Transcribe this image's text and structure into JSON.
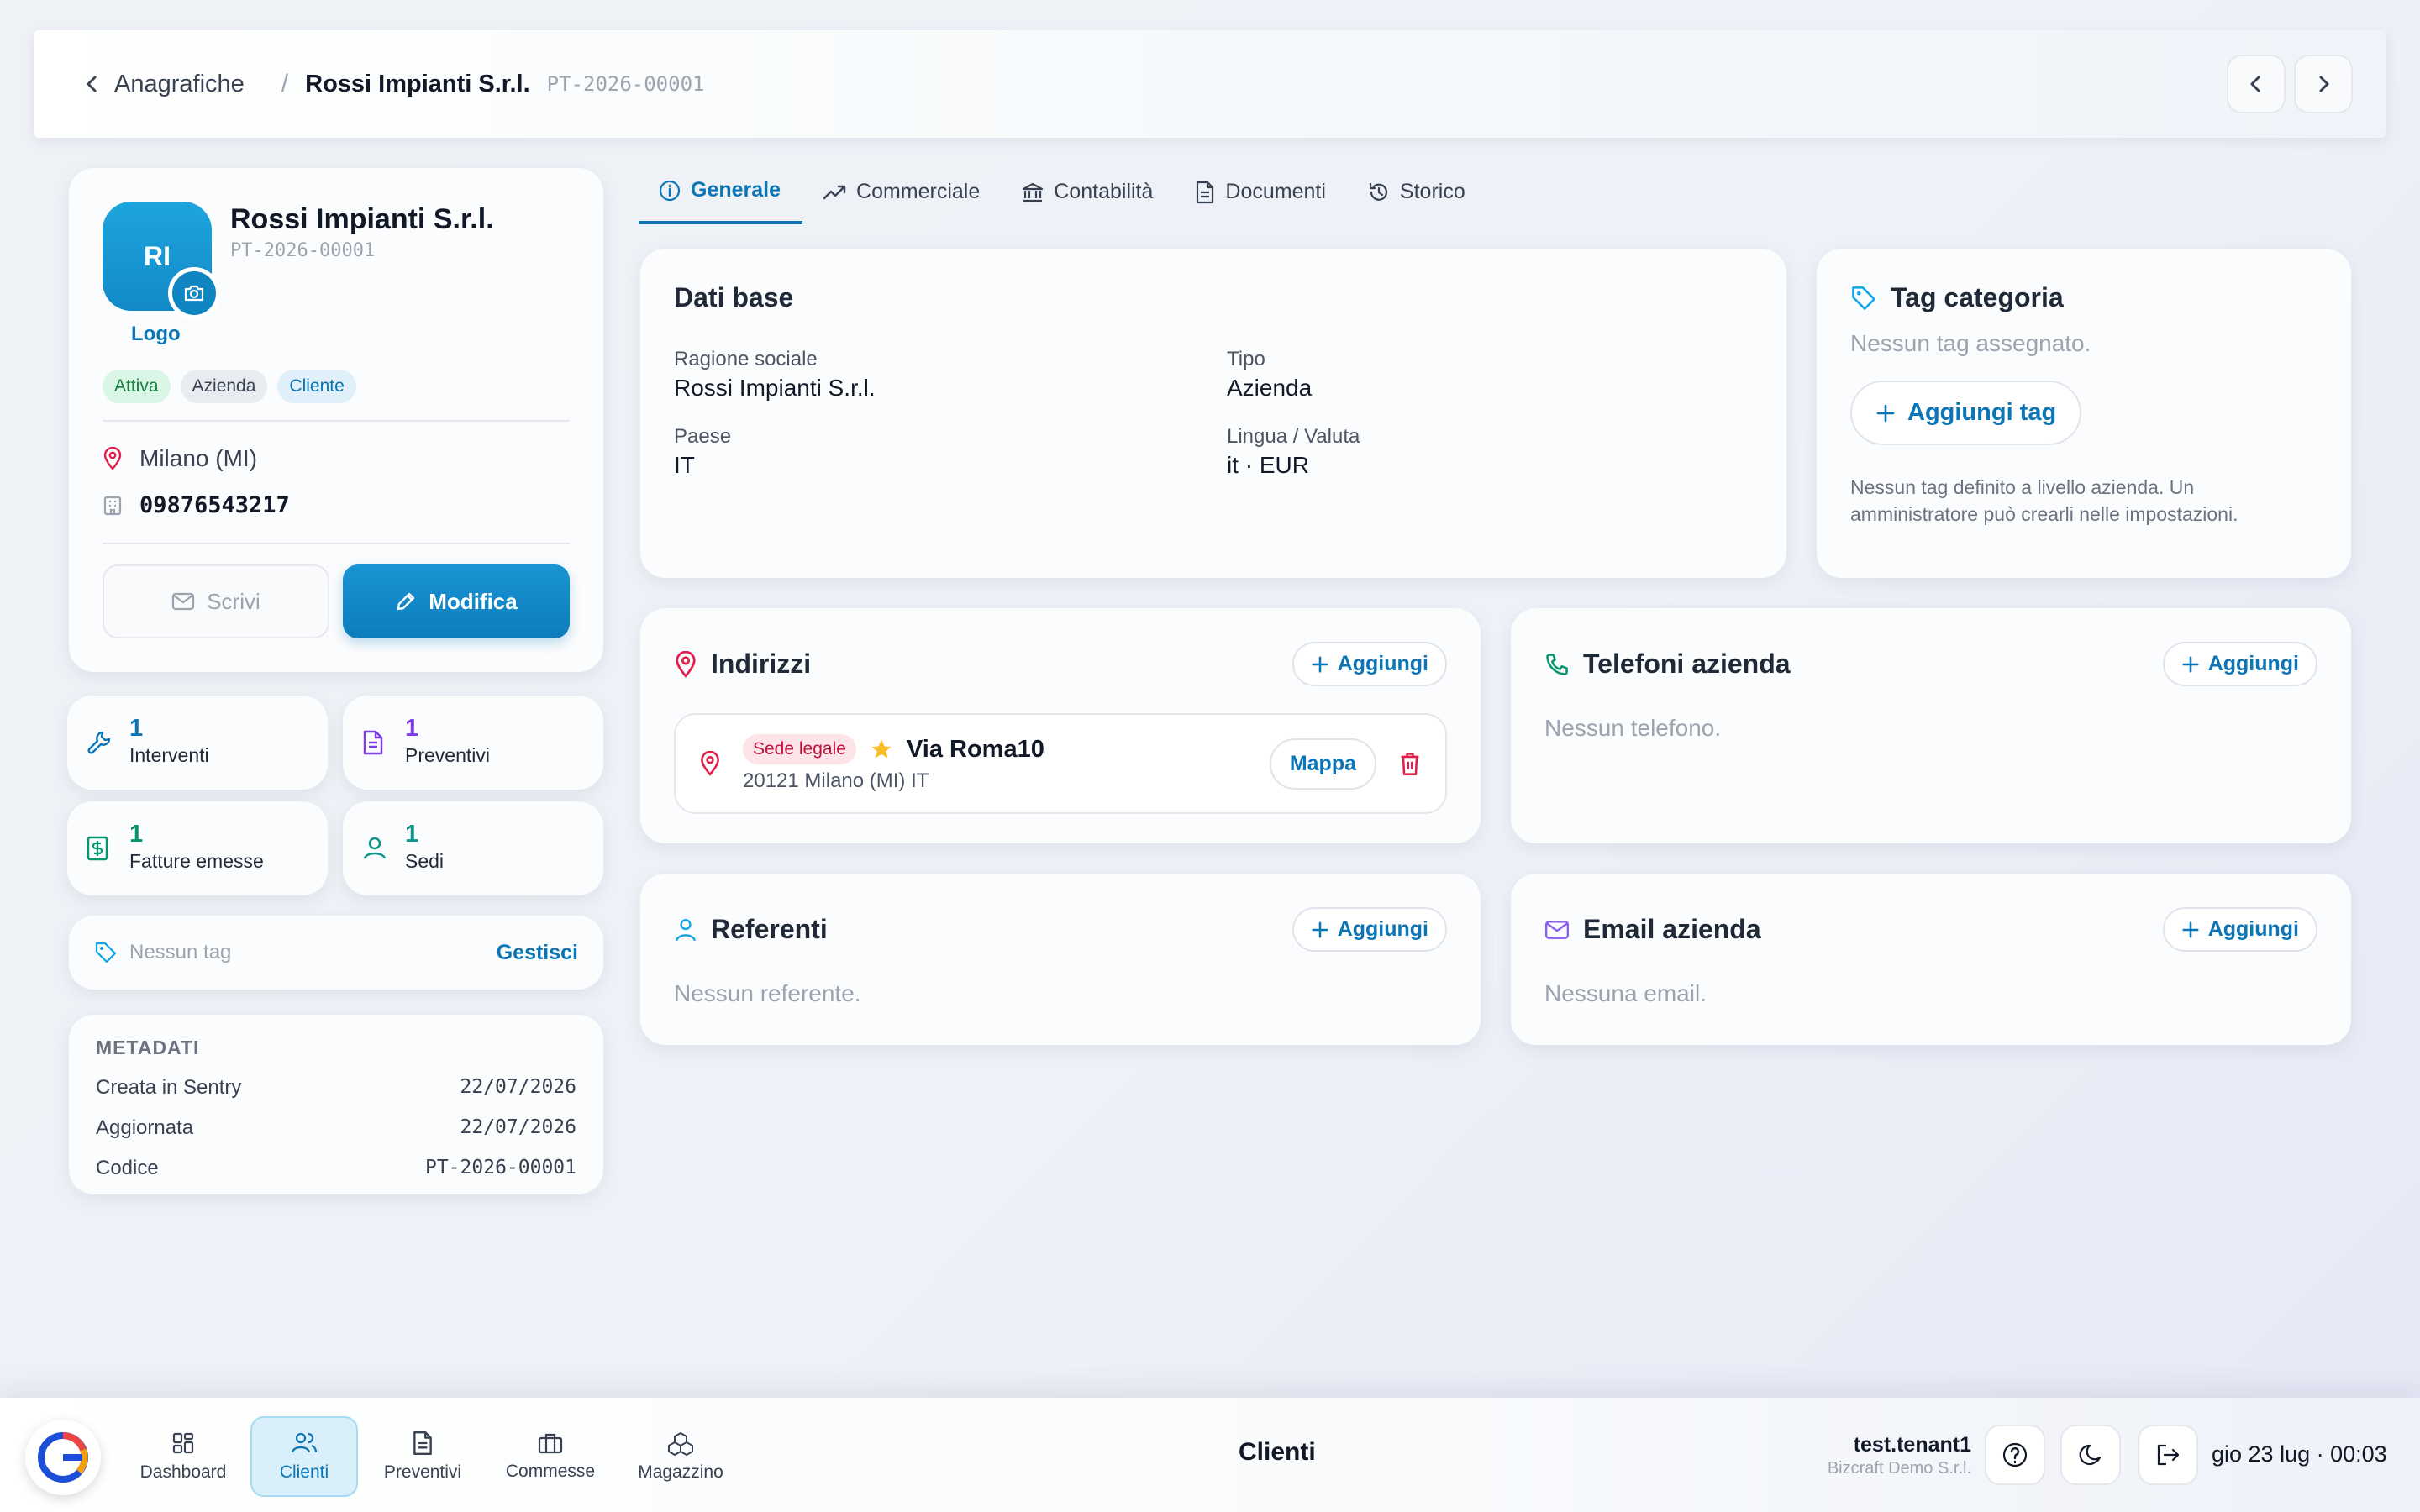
{
  "header": {
    "back_label": "Anagrafiche",
    "separator": "/",
    "current": "Rossi Impianti S.r.l.",
    "code": "PT-2026-00001"
  },
  "profile": {
    "initials": "RI",
    "logo_label": "Logo",
    "name": "Rossi Impianti S.r.l.",
    "code": "PT-2026-00001",
    "badges": [
      "Attiva",
      "Azienda",
      "Cliente"
    ],
    "location": "Milano (MI)",
    "vat": "09876543217",
    "write_label": "Scrivi",
    "edit_label": "Modifica"
  },
  "stats": [
    {
      "value": "1",
      "label": "Interventi",
      "color": "#0b75b5"
    },
    {
      "value": "1",
      "label": "Preventivi",
      "color": "#7c3aed"
    },
    {
      "value": "1",
      "label": "Fatture emesse",
      "color": "#059669"
    },
    {
      "value": "1",
      "label": "Sedi",
      "color": "#0d9488"
    }
  ],
  "tagbar": {
    "text": "Nessun tag",
    "action": "Gestisci"
  },
  "metadata": {
    "title": "METADATI",
    "rows": [
      {
        "label": "Creata in Sentry",
        "value": "22/07/2026"
      },
      {
        "label": "Aggiornata",
        "value": "22/07/2026"
      },
      {
        "label": "Codice",
        "value": "PT-2026-00001"
      }
    ]
  },
  "tabs": [
    "Generale",
    "Commerciale",
    "Contabilità",
    "Documenti",
    "Storico"
  ],
  "dati_base": {
    "title": "Dati base",
    "fields": [
      {
        "label": "Ragione sociale",
        "value": "Rossi Impianti S.r.l."
      },
      {
        "label": "Tipo",
        "value": "Azienda"
      },
      {
        "label": "Paese",
        "value": "IT"
      },
      {
        "label": "Lingua / Valuta",
        "value": "it · EUR"
      }
    ]
  },
  "tag_categoria": {
    "title": "Tag categoria",
    "empty": "Nessun tag assegnato.",
    "add_label": "Aggiungi tag",
    "note": "Nessun tag definito a livello azienda. Un amministratore può crearli nelle impostazioni."
  },
  "indirizzi": {
    "title": "Indirizzi",
    "add_label": "Aggiungi",
    "item": {
      "badge": "Sede legale",
      "street": "Via Roma10",
      "city": "20121 Milano (MI) IT",
      "map_label": "Mappa"
    }
  },
  "telefoni": {
    "title": "Telefoni azienda",
    "add_label": "Aggiungi",
    "empty": "Nessun telefono."
  },
  "referenti": {
    "title": "Referenti",
    "add_label": "Aggiungi",
    "empty": "Nessun referente."
  },
  "email": {
    "title": "Email azienda",
    "add_label": "Aggiungi",
    "empty": "Nessuna email."
  },
  "bottom_nav": {
    "items": [
      "Dashboard",
      "Clienti",
      "Preventivi",
      "Commesse",
      "Magazzino"
    ],
    "active": "Clienti",
    "page_title": "Clienti",
    "user": "test.tenant1",
    "org": "Bizcraft Demo S.r.l.",
    "clock": "gio 23 lug · 00:03"
  }
}
